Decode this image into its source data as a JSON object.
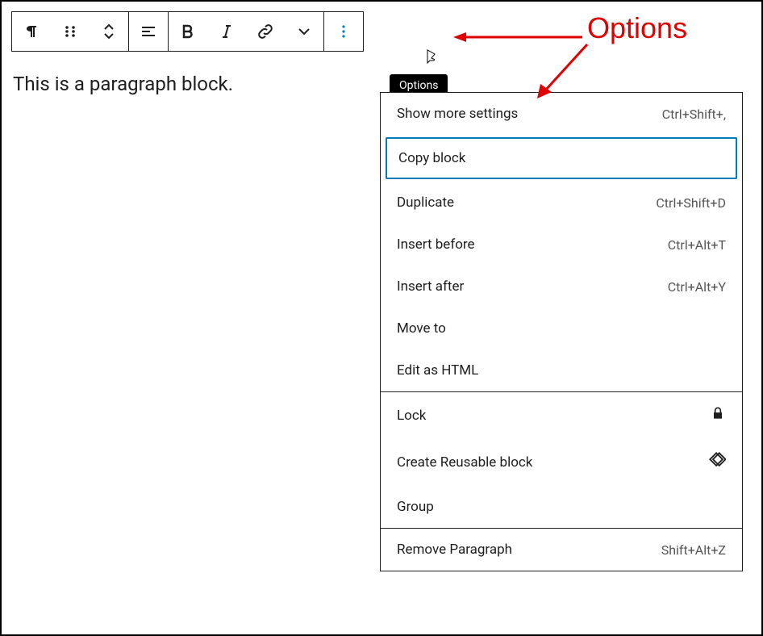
{
  "annotation": {
    "label": "Options"
  },
  "paragraph": {
    "text": "This is a paragraph block."
  },
  "tooltip": {
    "text": "Options"
  },
  "menu": {
    "items": [
      {
        "label": "Show more settings",
        "shortcut": "Ctrl+Shift+,"
      },
      {
        "label": "Copy block",
        "shortcut": ""
      },
      {
        "label": "Duplicate",
        "shortcut": "Ctrl+Shift+D"
      },
      {
        "label": "Insert before",
        "shortcut": "Ctrl+Alt+T"
      },
      {
        "label": "Insert after",
        "shortcut": "Ctrl+Alt+Y"
      },
      {
        "label": "Move to",
        "shortcut": ""
      },
      {
        "label": "Edit as HTML",
        "shortcut": ""
      },
      {
        "label": "Lock",
        "shortcut": "",
        "icon": "lock"
      },
      {
        "label": "Create Reusable block",
        "shortcut": "",
        "icon": "reusable"
      },
      {
        "label": "Group",
        "shortcut": ""
      },
      {
        "label": "Remove Paragraph",
        "shortcut": "Shift+Alt+Z"
      }
    ]
  }
}
